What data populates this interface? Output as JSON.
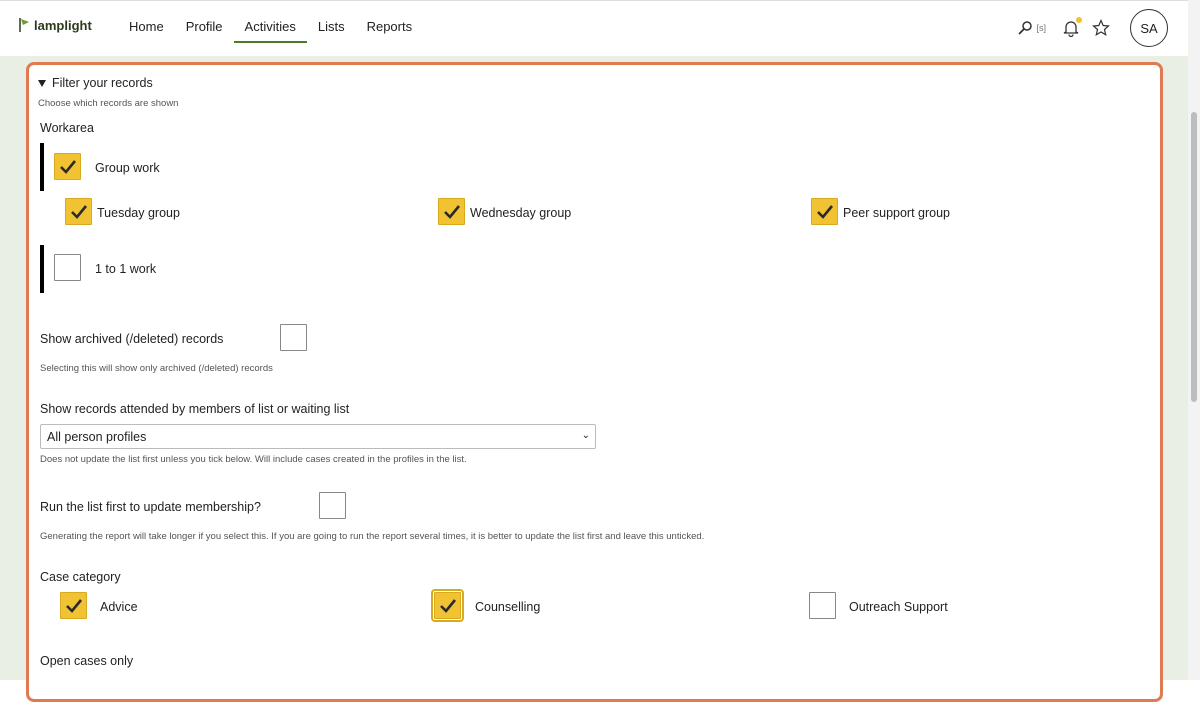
{
  "header": {
    "logo_text": "lamplight",
    "nav": [
      {
        "label": "Home",
        "active": false
      },
      {
        "label": "Profile",
        "active": false
      },
      {
        "label": "Activities",
        "active": true
      },
      {
        "label": "Lists",
        "active": false
      },
      {
        "label": "Reports",
        "active": false
      }
    ],
    "search_shortcut": "[s]",
    "avatar_initials": "SA",
    "icons": [
      "search-icon",
      "bell-icon",
      "star-icon"
    ]
  },
  "filter": {
    "title": "Filter your records",
    "subtitle": "Choose which records are shown",
    "workarea_label": "Workarea",
    "groups": [
      {
        "label": "Group work",
        "checked": true,
        "children": [
          {
            "label": "Tuesday group",
            "checked": true
          },
          {
            "label": "Wednesday group",
            "checked": true
          },
          {
            "label": "Peer support group",
            "checked": true
          }
        ]
      },
      {
        "label": "1 to 1 work",
        "checked": false,
        "children": []
      }
    ],
    "archived_label": "Show archived (/deleted) records",
    "archived_help": "Selecting this will show only archived (/deleted) records",
    "archived_checked": false,
    "list_label": "Show records attended by members of list or waiting list",
    "list_value": "All person profiles",
    "list_help": "Does not update the list first unless you tick below. Will include cases created in the profiles in the list.",
    "runlist_label": "Run the list first to update membership?",
    "runlist_checked": false,
    "runlist_help": "Generating the report will take longer if you select this. If you are going to run the report several times, it is better to update the list first and leave this unticked.",
    "case_category_label": "Case category",
    "case_categories": [
      {
        "label": "Advice",
        "checked": true
      },
      {
        "label": "Counselling",
        "checked": true
      },
      {
        "label": "Outreach Support",
        "checked": false
      }
    ],
    "open_cases_label": "Open cases only"
  },
  "colors": {
    "accent": "#e07a52",
    "check": "#f1c232",
    "nav_active": "#4b7a29",
    "background": "#e9efe4"
  }
}
